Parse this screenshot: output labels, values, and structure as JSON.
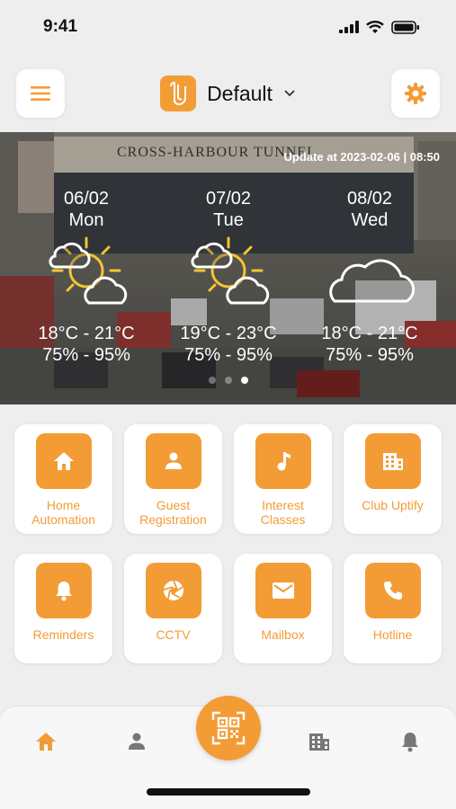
{
  "status_bar": {
    "time": "9:41"
  },
  "header": {
    "profile_name": "Default"
  },
  "weather": {
    "update_text": "Update at 2023-02-06 | 08:50",
    "background_sign": "CROSS-HARBOUR TUNNEL",
    "days": [
      {
        "date": "06/02",
        "day": "Mon",
        "icon": "partly-cloudy-icon",
        "temp": "18°C - 21°C",
        "humidity": "75% - 95%"
      },
      {
        "date": "07/02",
        "day": "Tue",
        "icon": "partly-cloudy-icon",
        "temp": "19°C - 23°C",
        "humidity": "75% - 95%"
      },
      {
        "date": "08/02",
        "day": "Wed",
        "icon": "cloud-icon",
        "temp": "18°C - 21°C",
        "humidity": "75% - 95%"
      }
    ],
    "page_count": 3,
    "active_page": 3
  },
  "tiles": [
    {
      "label": "Home\nAutomation",
      "icon": "home-icon"
    },
    {
      "label": "Guest\nRegistration",
      "icon": "person-icon"
    },
    {
      "label": "Interest\nClasses",
      "icon": "music-note-icon"
    },
    {
      "label": "Club Uptify",
      "icon": "building-icon"
    },
    {
      "label": "Reminders",
      "icon": "bell-icon"
    },
    {
      "label": "CCTV",
      "icon": "camera-shutter-icon"
    },
    {
      "label": "Mailbox",
      "icon": "mail-icon"
    },
    {
      "label": "Hotline",
      "icon": "phone-icon"
    }
  ],
  "tabbar": {
    "tabs": [
      {
        "icon": "home-icon",
        "active": true
      },
      {
        "icon": "person-icon",
        "active": false
      },
      {
        "icon": "qr-scan-icon",
        "active": false
      },
      {
        "icon": "building-icon",
        "active": false
      },
      {
        "icon": "bell-icon",
        "active": false
      }
    ]
  },
  "colors": {
    "accent": "#f39c36",
    "inactive_tab": "#777777",
    "background": "#eeeeee"
  }
}
